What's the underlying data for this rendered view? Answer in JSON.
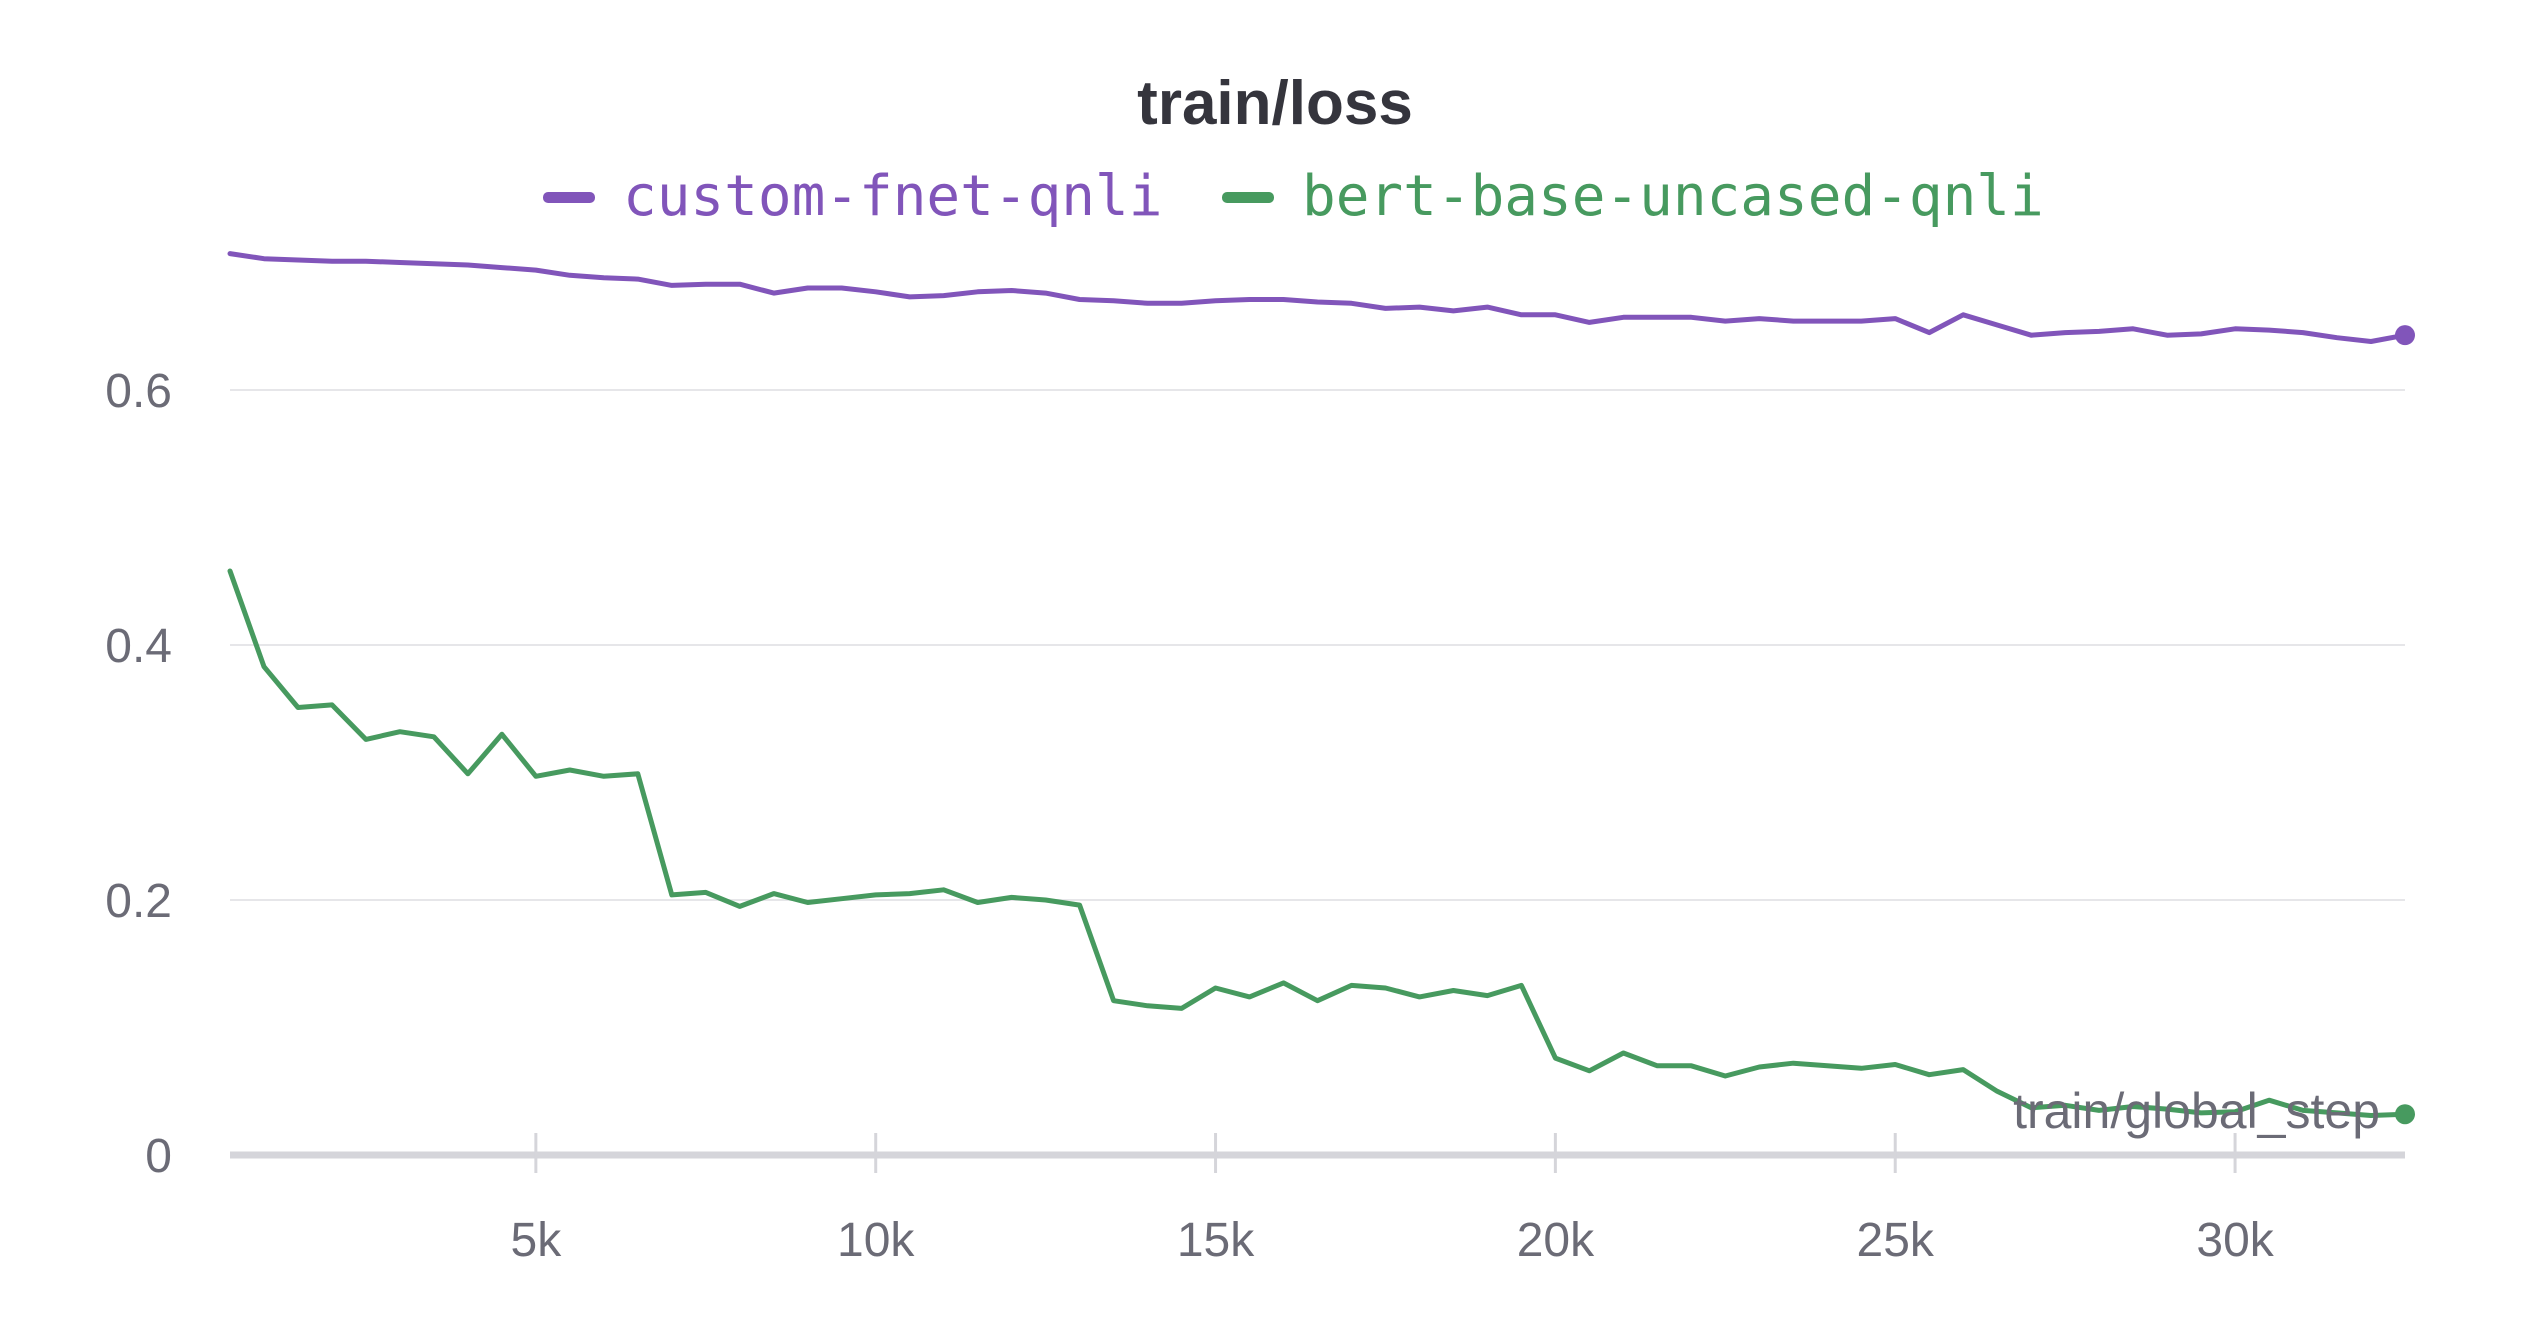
{
  "chart_data": {
    "type": "line",
    "title": "train/loss",
    "xlabel": "train/global_step",
    "ylabel": "",
    "xlim": [
      500,
      32500
    ],
    "ylim": [
      0,
      0.72
    ],
    "x_ticks": [
      5000,
      10000,
      15000,
      20000,
      25000,
      30000
    ],
    "x_tick_labels": [
      "5k",
      "10k",
      "15k",
      "20k",
      "25k",
      "30k"
    ],
    "y_ticks": [
      0,
      0.2,
      0.4,
      0.6
    ],
    "y_tick_labels": [
      "0",
      "0.2",
      "0.4",
      "0.6"
    ],
    "grid": "horizontal",
    "legend_position": "top-center",
    "series": [
      {
        "name": "custom-fnet-qnli",
        "color": "#8155ba",
        "x": [
          500,
          1000,
          1500,
          2000,
          2500,
          3000,
          3500,
          4000,
          4500,
          5000,
          5500,
          6000,
          6500,
          7000,
          7500,
          8000,
          8500,
          9000,
          9500,
          10000,
          10500,
          11000,
          11500,
          12000,
          12500,
          13000,
          13500,
          14000,
          14500,
          15000,
          15500,
          16000,
          16500,
          17000,
          17500,
          18000,
          18500,
          19000,
          19500,
          20000,
          20500,
          21000,
          21500,
          22000,
          22500,
          23000,
          23500,
          24000,
          24500,
          25000,
          25500,
          26000,
          26500,
          27000,
          27500,
          28000,
          28500,
          29000,
          29500,
          30000,
          30500,
          31000,
          31500,
          32000,
          32500
        ],
        "values": [
          0.707,
          0.703,
          0.702,
          0.701,
          0.701,
          0.7,
          0.699,
          0.698,
          0.696,
          0.694,
          0.69,
          0.688,
          0.687,
          0.682,
          0.683,
          0.683,
          0.676,
          0.68,
          0.68,
          0.677,
          0.673,
          0.674,
          0.677,
          0.678,
          0.676,
          0.671,
          0.67,
          0.668,
          0.668,
          0.67,
          0.671,
          0.671,
          0.669,
          0.668,
          0.664,
          0.665,
          0.662,
          0.665,
          0.659,
          0.659,
          0.653,
          0.657,
          0.657,
          0.657,
          0.654,
          0.656,
          0.654,
          0.654,
          0.654,
          0.656,
          0.645,
          0.659,
          0.651,
          0.643,
          0.645,
          0.646,
          0.648,
          0.643,
          0.644,
          0.648,
          0.647,
          0.645,
          0.641,
          0.638,
          0.643
        ]
      },
      {
        "name": "bert-base-uncased-qnli",
        "color": "#479a5f",
        "x": [
          500,
          1000,
          1500,
          2000,
          2500,
          3000,
          3500,
          4000,
          4500,
          5000,
          5500,
          6000,
          6500,
          7000,
          7500,
          8000,
          8500,
          9000,
          9500,
          10000,
          10500,
          11000,
          11500,
          12000,
          12500,
          13000,
          13500,
          14000,
          14500,
          15000,
          15500,
          16000,
          16500,
          17000,
          17500,
          18000,
          18500,
          19000,
          19500,
          20000,
          20500,
          21000,
          21500,
          22000,
          22500,
          23000,
          23500,
          24000,
          24500,
          25000,
          25500,
          26000,
          26500,
          27000,
          27500,
          28000,
          28500,
          29000,
          29500,
          30000,
          30500,
          31000,
          31500,
          32000,
          32500
        ],
        "values": [
          0.458,
          0.383,
          0.351,
          0.353,
          0.326,
          0.332,
          0.328,
          0.299,
          0.33,
          0.297,
          0.302,
          0.297,
          0.299,
          0.204,
          0.206,
          0.195,
          0.205,
          0.198,
          0.201,
          0.204,
          0.205,
          0.208,
          0.198,
          0.202,
          0.2,
          0.196,
          0.121,
          0.117,
          0.115,
          0.131,
          0.124,
          0.135,
          0.121,
          0.133,
          0.131,
          0.124,
          0.129,
          0.125,
          0.133,
          0.076,
          0.066,
          0.08,
          0.07,
          0.07,
          0.062,
          0.069,
          0.072,
          0.07,
          0.068,
          0.071,
          0.063,
          0.067,
          0.05,
          0.037,
          0.039,
          0.035,
          0.038,
          0.036,
          0.033,
          0.034,
          0.043,
          0.035,
          0.033,
          0.031,
          0.032
        ]
      }
    ]
  }
}
